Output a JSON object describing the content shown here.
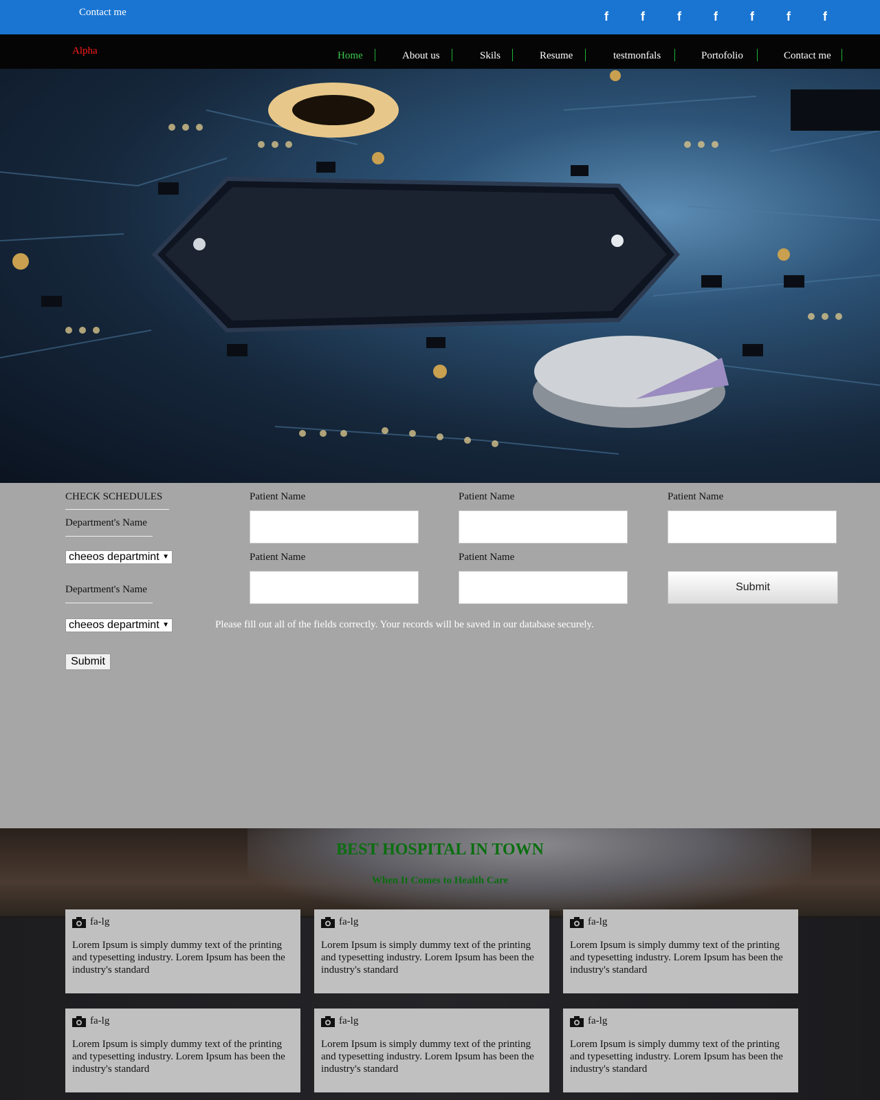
{
  "topbar": {
    "contact_label": "Contact me",
    "social_icons": [
      "facebook-icon",
      "facebook-icon",
      "facebook-icon",
      "facebook-icon",
      "facebook-icon",
      "facebook-icon",
      "facebook-icon"
    ],
    "social_glyph": "f",
    "color": "#1a75d2"
  },
  "nav": {
    "brand": "Alpha",
    "items": [
      {
        "label": "Home",
        "active": true
      },
      {
        "label": "About us"
      },
      {
        "label": "Skils"
      },
      {
        "label": "Resume"
      },
      {
        "label": "testmonfals"
      },
      {
        "label": "Portofolio"
      },
      {
        "label": "Contact me"
      }
    ],
    "active_color": "#3cc94c",
    "separator_color": "#1db33a"
  },
  "schedule": {
    "heading": "CHECK SCHEDULES",
    "dept_label_1": "Department's Name",
    "dept_select_1": "cheeos departmint",
    "dept_label_2": "Department's Name",
    "dept_select_2": "cheeos departmint",
    "submit": "Submit"
  },
  "patient_form": {
    "labels": [
      "Patient Name",
      "Patient Name",
      "Patient Name",
      "Patient Name",
      "Patient Name"
    ],
    "values": [
      "",
      "",
      "",
      "",
      ""
    ],
    "submit": "Submit",
    "note": "Please fill out all of the fields correctly. Your records will be saved in our database securely."
  },
  "features": {
    "title": "BEST HOSPITAL IN TOWN",
    "subtitle": "When It Comes to Health Care",
    "title_color": "#0b6e10",
    "cards": [
      {
        "icon": "camera-icon",
        "caption": "fa-lg",
        "text": "Lorem Ipsum is simply dummy text of the printing and typesetting industry. Lorem Ipsum has been the industry's standard"
      },
      {
        "icon": "camera-icon",
        "caption": "fa-lg",
        "text": "Lorem Ipsum is simply dummy text of the printing and typesetting industry. Lorem Ipsum has been the industry's standard"
      },
      {
        "icon": "camera-icon",
        "caption": "fa-lg",
        "text": "Lorem Ipsum is simply dummy text of the printing and typesetting industry. Lorem Ipsum has been the industry's standard"
      },
      {
        "icon": "camera-icon",
        "caption": "fa-lg",
        "text": "Lorem Ipsum is simply dummy text of the printing and typesetting industry. Lorem Ipsum has been the industry's standard"
      },
      {
        "icon": "camera-icon",
        "caption": "fa-lg",
        "text": "Lorem Ipsum is simply dummy text of the printing and typesetting industry. Lorem Ipsum has been the industry's standard"
      },
      {
        "icon": "camera-icon",
        "caption": "fa-lg",
        "text": "Lorem Ipsum is simply dummy text of the printing and typesetting industry. Lorem Ipsum has been the industry's standard"
      }
    ]
  }
}
